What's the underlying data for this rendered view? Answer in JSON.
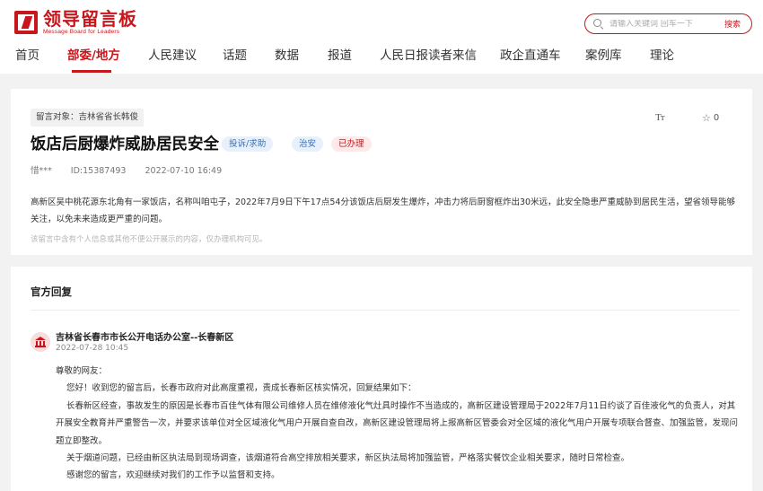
{
  "header": {
    "logo_cn": "领导留言板",
    "logo_en": "Message Board for Leaders",
    "search_placeholder": "请输入关键词 回车一下",
    "search_button": "搜索"
  },
  "nav": [
    {
      "label": "首页",
      "active": false
    },
    {
      "label": "部委/地方",
      "active": true
    },
    {
      "label": "人民建议",
      "active": false
    },
    {
      "label": "话题",
      "active": false
    },
    {
      "label": "数据",
      "active": false
    },
    {
      "label": "报道",
      "active": false
    },
    {
      "label": "人民日报读者来信",
      "active": false
    },
    {
      "label": "政企直通车",
      "active": false
    },
    {
      "label": "案例库",
      "active": false
    },
    {
      "label": "理论",
      "active": false
    }
  ],
  "message": {
    "target": "留言对象：吉林省省长韩俊",
    "font_icon": "Tт",
    "star_count": "0",
    "title": "饭店后厨爆炸威胁居民安全",
    "type_badge": "投诉/求助",
    "field_badge": "治安",
    "status_badge": "已办理",
    "author": "惜***",
    "id": "ID:15387493",
    "datetime": "2022-07-10 16:49",
    "content": "高新区吴中桃花源东北角有一家饭店，名称叫咱屯子，2022年7月9日下午17点54分该饭店后厨发生爆炸，冲击力将后厨窗框炸出30米远，此安全隐患严重威胁到居民生活，望省领导能够关注，以免未来造成更严重的问题。",
    "privacy_note": "该留言中含有个人信息或其他不便公开展示的内容，仅办理机构可见。"
  },
  "reply": {
    "heading": "官方回复",
    "org": "吉林省长春市市长公开电话办公室--长春新区",
    "date": "2022-07-28 10:45",
    "greeting": "尊敬的网友：",
    "p1": "您好！收到您的留言后，长春市政府对此高度重视，责成长春新区核实情况，回复结果如下：",
    "p2": "长春新区经查，事故发生的原因是长春市百佳气体有限公司维修人员在维修液化气灶具时操作不当造成的，高新区建设管理局于2022年7月11日约谈了百佳液化气的负责人，对其开展安全教育并严重警告一次，并要求该单位对全区域液化气用户开展自查自改，高新区建设管理局将上报高新区管委会对全区域的液化气用户开展专项联合督查、加强监管，发现问题立即整改。",
    "p3": "关于烟道问题，已经由新区执法局到现场调查，该烟道符合高空排放相关要求，新区执法局将加强监管，严格落实餐饮企业相关要求，随时日常检查。",
    "p4": "感谢您的留言，欢迎继续对我们的工作予以监督和支持。"
  },
  "colors": {
    "brand": "#c8161d",
    "badge_blue_bg": "#e7f0fb",
    "badge_red_bg": "#fde9e9"
  }
}
